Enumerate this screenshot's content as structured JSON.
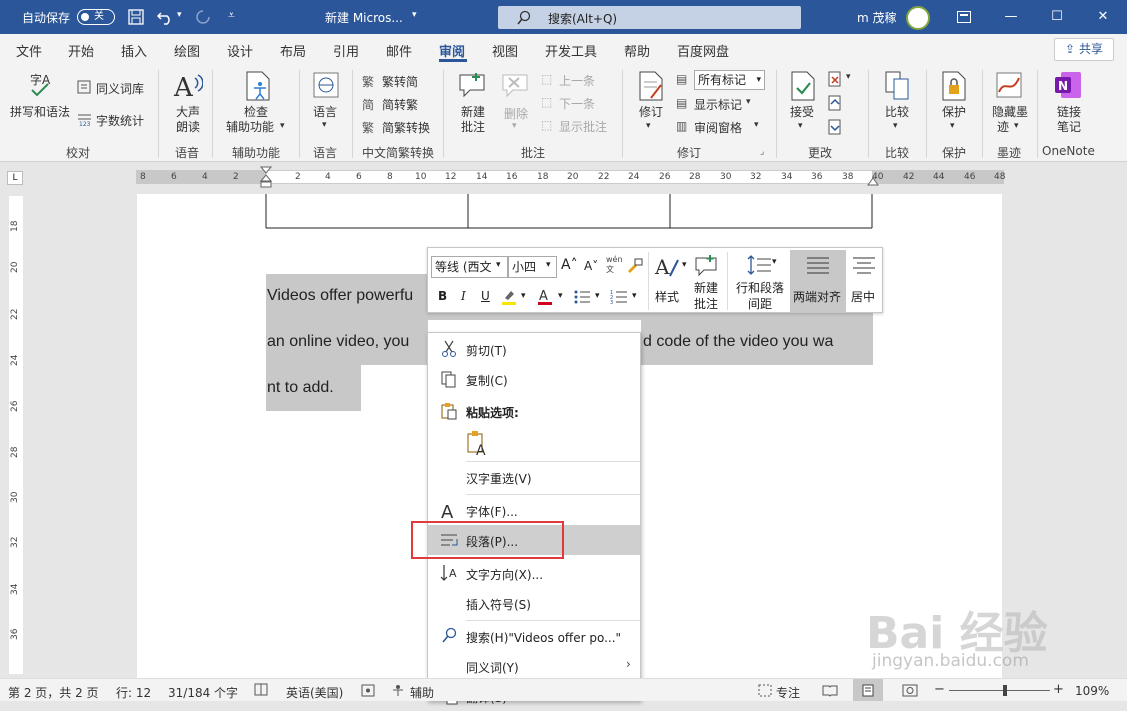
{
  "titlebar": {
    "autosave_label": "自动保存",
    "autosave_state": "关",
    "doc_title": "新建 Micros...",
    "search_placeholder": "搜索(Alt+Q)",
    "user_name": "m 茂稼",
    "colors": {
      "brand": "#2b579a"
    }
  },
  "tabs": [
    "文件",
    "开始",
    "插入",
    "绘图",
    "设计",
    "布局",
    "引用",
    "邮件",
    "审阅",
    "视图",
    "开发工具",
    "帮助",
    "百度网盘"
  ],
  "active_tab": "审阅",
  "share_label": "共享",
  "ribbon": {
    "proofing": {
      "spell": "拼写和语法",
      "thesaurus": "同义词库",
      "wordcount": "字数统计",
      "title": "校对"
    },
    "speech": {
      "read_aloud_1": "大声",
      "read_aloud_2": "朗读",
      "title": "语音"
    },
    "accessibility": {
      "check_1": "检查",
      "check_2": "辅助功能",
      "title": "辅助功能"
    },
    "language": {
      "label": "语言",
      "title": "语言"
    },
    "chinese": {
      "to_trad": "繁转简",
      "to_simp": "简转繁",
      "convert": "简繁转换",
      "title": "中文简繁转换"
    },
    "comments": {
      "new_1": "新建",
      "new_2": "批注",
      "delete": "删除",
      "prev": "上一条",
      "next": "下一条",
      "show": "显示批注",
      "title": "批注"
    },
    "tracking": {
      "track": "修订",
      "markup_select": "所有标记",
      "show_markup": "显示标记",
      "pane": "审阅窗格",
      "title": "修订"
    },
    "changes": {
      "accept": "接受",
      "title": "更改"
    },
    "compare": {
      "label": "比较",
      "title": "比较"
    },
    "protect": {
      "label": "保护",
      "title": "保护"
    },
    "ink": {
      "hide_1": "隐藏墨",
      "hide_2": "迹",
      "title": "墨迹"
    },
    "onenote": {
      "link_1": "链接",
      "link_2": "笔记",
      "title": "OneNote"
    }
  },
  "ruler": {
    "h_numbers": [
      "8",
      "6",
      "4",
      "2",
      "2",
      "4",
      "6",
      "8",
      "10",
      "12",
      "14",
      "16",
      "18",
      "20",
      "22",
      "24",
      "26",
      "28",
      "30",
      "32",
      "34",
      "36",
      "38",
      "40",
      "42",
      "44",
      "46",
      "48"
    ],
    "v_numbers": [
      "18",
      "20",
      "22",
      "24",
      "26",
      "28",
      "30",
      "32",
      "34",
      "36"
    ]
  },
  "document": {
    "line1": "Videos offer powerfu",
    "line2a": "an online video, you",
    "line2b": "d code of the video you wa",
    "line3": "nt to add."
  },
  "minitoolbar": {
    "font": "等线 (西文",
    "size": "小四",
    "styles": "样式",
    "new_comment_1": "新建",
    "new_comment_2": "批注",
    "spacing_1": "行和段落",
    "spacing_2": "间距",
    "justify": "两端对齐",
    "center": "居中"
  },
  "context_menu": {
    "cut": "剪切(T)",
    "copy": "复制(C)",
    "paste_options": "粘贴选项:",
    "reconvert": "汉字重选(V)",
    "font": "字体(F)...",
    "paragraph": "段落(P)...",
    "text_direction": "文字方向(X)...",
    "insert_symbol": "插入符号(S)",
    "search": "搜索(H)\"Videos offer po...\"",
    "synonyms": "同义词(Y)",
    "translate": "翻译(S)"
  },
  "statusbar": {
    "page": "第 2 页，共 2 页",
    "line": "行: 12",
    "words": "31/184 个字",
    "language": "英语(美国)",
    "accessibility": "辅助",
    "focus": "专注",
    "zoom": "109%",
    "zoom_fraction": 0.55
  },
  "watermark": {
    "logo": "Bai 经验",
    "url": "jingyan.baidu.com"
  }
}
